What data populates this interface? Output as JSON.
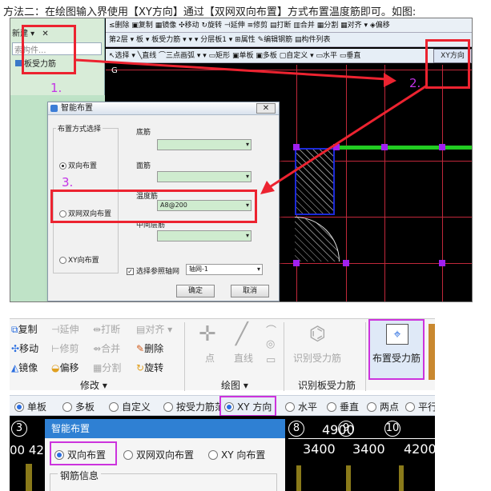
{
  "caption": "方法二：在绘图输入界使用【XY方向】通过【双网双向布置】方式布置温度筋即可。如图:",
  "top": {
    "left_panel": {
      "new_label": "新建 ▾",
      "close_glyph": "✕",
      "search_placeholder": "索构件...",
      "tree_item": "板受力筋"
    },
    "toolbar_row1": "≤删除  ▣复制  ▦镜像  ✣移动  ↻旋转  ⊣延伸  ≡修剪  ▤打断  ▥合并  ▦分割  ▦对齐 ▾  ◈偏移",
    "toolbar_row2": "第2层 ▾  板 ▾  板受力筋 ▾  ▾  ▾  分层板1 ▾  ⊞属性  ✎编辑钢筋  ▤构件列表",
    "toolbar_row3": "↖选择 ▾  ╲直线  ⌒三点画弧 ▾   ▾   ▭矩形  ▣单板  ▣多板  ▢自定义 ▾  ▭水平  ▭垂直",
    "xy_button": "XY方向",
    "grid_label_g": "G",
    "annotations": {
      "n1": "1.",
      "n2": "2.",
      "n3": "3."
    },
    "dialog": {
      "title": "智能布置",
      "close": "✕",
      "group_title": "布置方式选择",
      "opt_two_way": "双向布置",
      "opt_double_net": "双网双向布置",
      "opt_xy": "XY向布置",
      "bottom_bar_label": "底筋",
      "top_bar_label": "面筋",
      "temp_bar_label": "温度筋",
      "temp_bar_value": "A8@200",
      "mid_bar_label": "中间层筋",
      "checkbox_label": "选择参照轴网",
      "axis_select": "轴网-1",
      "ok": "确定",
      "cancel": "取消"
    }
  },
  "ribbon": {
    "copy": "复制",
    "extend": "延伸",
    "break": "打断",
    "align": "对齐",
    "move": "移动",
    "trim": "修剪",
    "merge": "合并",
    "delete": "删除",
    "mirror": "镜像",
    "offset": "偏移",
    "split": "分割",
    "rotate": "旋转",
    "modify_group": "修改 ▾",
    "point": "点",
    "line": "直线",
    "draw_group": "绘图 ▾",
    "identify": "识别受力筋",
    "identify_group": "识别板受力筋",
    "place": "布置受力筋"
  },
  "radio_bar": {
    "single": "单板",
    "multi": "多板",
    "custom": "自定义",
    "by_range": "按受力筋范围",
    "xy": "XY 方向",
    "horizontal": "水平",
    "vertical": "垂直",
    "two_point": "两点",
    "parallel": "平行"
  },
  "bottom": {
    "dialog_title": "智能布置",
    "opt_two_way": "双向布置",
    "opt_double_net": "双网双向布置",
    "opt_xy": "XY 向布置",
    "rebar_info": "钢筋信息",
    "axis_3": "3",
    "axis_8": "8",
    "axis_9": "9",
    "axis_10": "10",
    "dim_4900": "4900",
    "dim_3400a": "3400",
    "dim_3400b": "3400",
    "dim_4200": "4200",
    "left_dim": "00  42"
  },
  "colors": {
    "highlight_red": "#ec2330",
    "highlight_purple": "#cc33dd",
    "title_blue": "#2f80d3",
    "green_beam": "#22cc22"
  }
}
